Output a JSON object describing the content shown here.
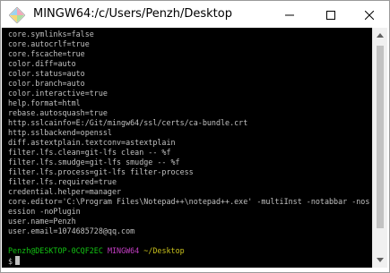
{
  "window": {
    "title": "MINGW64:/c/Users/Penzh/Desktop",
    "icon": "git-bash-diamond-icon",
    "controls": [
      "minimize-icon",
      "maximize-icon",
      "close-icon"
    ]
  },
  "terminal": {
    "colors": {
      "background": "#000000",
      "text": "#c0c0c0",
      "user": "#13c213",
      "env": "#c43ec4",
      "path": "#c8c01c"
    },
    "lines": [
      "core.symlinks=false",
      "core.autocrlf=true",
      "core.fscache=true",
      "color.diff=auto",
      "color.status=auto",
      "color.branch=auto",
      "color.interactive=true",
      "help.format=html",
      "rebase.autosquash=true",
      "http.sslcainfo=E:/Git/mingw64/ssl/certs/ca-bundle.crt",
      "http.sslbackend=openssl",
      "diff.astextplain.textconv=astextplain",
      "filter.lfs.clean=git-lfs clean -- %f",
      "filter.lfs.smudge=git-lfs smudge -- %f",
      "filter.lfs.process=git-lfs filter-process",
      "filter.lfs.required=true",
      "credential.helper=manager",
      "core.editor='C:\\Program Files\\Notepad++\\notepad++.exe' -multiInst -notabbar -nos",
      "ession -noPlugin",
      "user.name=Penzh",
      "user.email=1074685728@qq.com",
      ""
    ],
    "prompt": {
      "user_host": "Penzh@DESKTOP-0CQF2EC",
      "env": "MINGW64",
      "path": "~/Desktop",
      "symbol": "$"
    }
  }
}
